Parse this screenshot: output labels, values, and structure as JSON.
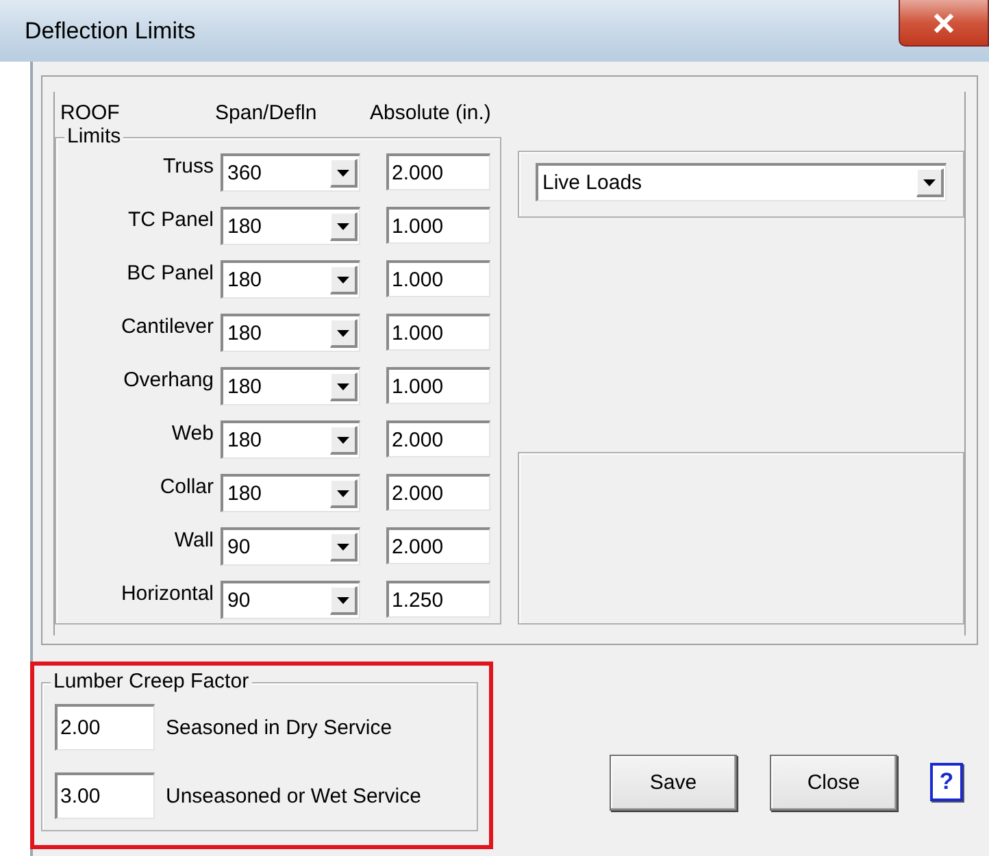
{
  "window": {
    "title": "Deflection Limits"
  },
  "roof": {
    "label": "ROOF",
    "columns": [
      "Span/Defln",
      "Absolute (in.)"
    ],
    "group": "Limits",
    "rows": [
      {
        "name": "Truss",
        "span": "360",
        "absolute": "2.000"
      },
      {
        "name": "TC Panel",
        "span": "180",
        "absolute": "1.000"
      },
      {
        "name": "BC Panel",
        "span": "180",
        "absolute": "1.000"
      },
      {
        "name": "Cantilever",
        "span": "180",
        "absolute": "1.000"
      },
      {
        "name": "Overhang",
        "span": "180",
        "absolute": "1.000"
      },
      {
        "name": "Web",
        "span": "180",
        "absolute": "2.000"
      },
      {
        "name": "Collar",
        "span": "180",
        "absolute": "2.000"
      },
      {
        "name": "Wall",
        "span": "90",
        "absolute": "2.000"
      },
      {
        "name": "Horizontal",
        "span": "90",
        "absolute": "1.250"
      }
    ]
  },
  "load_type": {
    "value": "Live Loads"
  },
  "creep": {
    "title": "Lumber Creep Factor",
    "highlighted": true,
    "rows": [
      {
        "value": "2.00",
        "label": "Seasoned in Dry Service"
      },
      {
        "value": "3.00",
        "label": "Unseasoned or Wet Service"
      }
    ]
  },
  "buttons": [
    {
      "label": "Save"
    },
    {
      "label": "Close"
    }
  ],
  "help": "?"
}
